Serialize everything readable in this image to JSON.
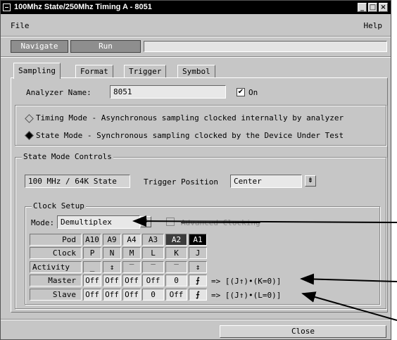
{
  "window": {
    "title": "100Mhz State/250Mhz Timing A - 8051",
    "min": "_",
    "restore": "□",
    "close": "×"
  },
  "menubar": {
    "file": "File",
    "help": "Help"
  },
  "nav": {
    "navigate": "Navigate",
    "run": "Run",
    "field_value": ""
  },
  "tabs": [
    "Sampling",
    "Format",
    "Trigger",
    "Symbol"
  ],
  "sampling": {
    "analyzer_name_label": "Analyzer Name:",
    "analyzer_name_value": "8051",
    "on_label": "On",
    "on_checked": "✔",
    "timing_mode": "Timing Mode - Asynchronous sampling clocked internally by analyzer",
    "state_mode": "State Mode  - Synchronous sampling clocked by the Device Under Test"
  },
  "state_controls": {
    "title": "State Mode Controls",
    "speed": "100 MHz / 64K State",
    "trigger_position_label": "Trigger Position",
    "trigger_position_value": "Center",
    "dropdown_icon": "⇟"
  },
  "clock_setup": {
    "title": "Clock Setup",
    "mode_label": "Mode:",
    "mode_value": "Demultiplex",
    "advanced_label": "Advanced Clocking",
    "table": {
      "row_labels": [
        "Pod",
        "Clock",
        "Activity",
        "Master",
        "Slave"
      ],
      "pods": [
        "A10",
        "A9",
        "A4",
        "A3",
        "A2",
        "A1"
      ],
      "clock": [
        "P",
        "N",
        "M",
        "L",
        "K",
        "J"
      ],
      "activity": [
        "_",
        "↕",
        "‾",
        "‾",
        "‾",
        "↕"
      ],
      "master": [
        "Off",
        "Off",
        "Off",
        "Off",
        "0",
        "⨍"
      ],
      "slave": [
        "Off",
        "Off",
        "Off",
        "0",
        "Off",
        "⨍"
      ],
      "master_expr": "=> [(J↑)•(K=0)]",
      "slave_expr": "=> [(J↑)•(L=0)]"
    }
  },
  "footer": {
    "close": "Close"
  }
}
